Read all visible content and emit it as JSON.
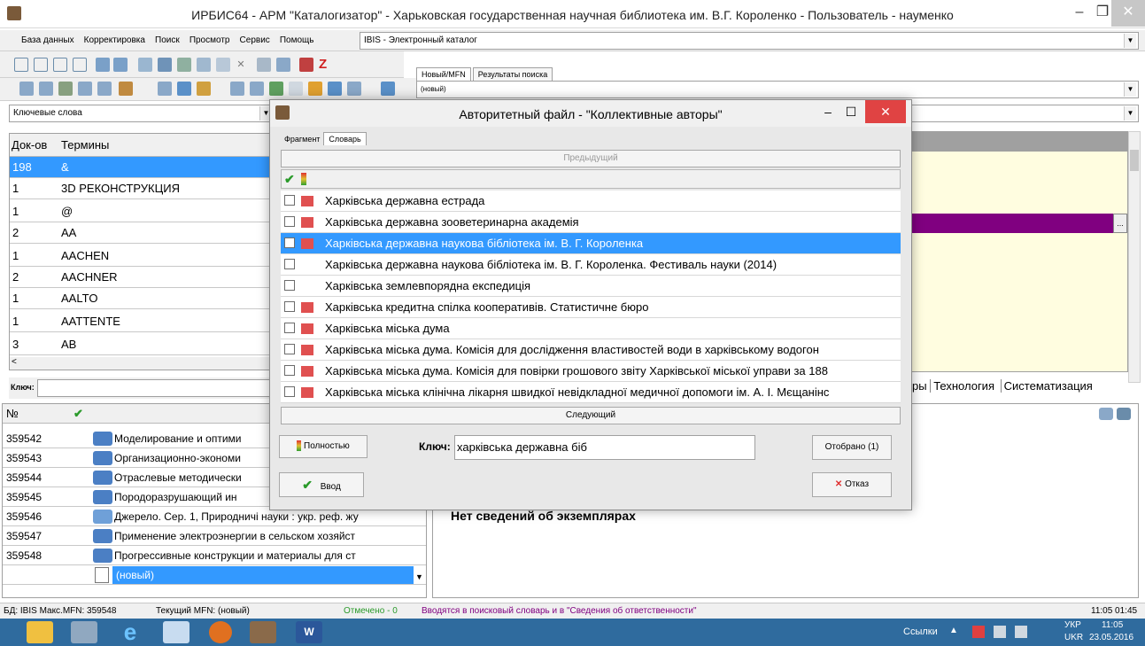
{
  "window": {
    "title": "ИРБИС64 - АРМ \"Каталогизатор\" - Харьковская государственная научная библиотека им. В.Г. Короленко - Пользователь - науменко"
  },
  "menu": [
    "База данных",
    "Корректировка",
    "Поиск",
    "Просмотр",
    "Сервис",
    "Помощь"
  ],
  "db_combo": "IBIS - Электронный каталог",
  "top_tabs": [
    "Новый/MFN",
    "Результаты поиска"
  ],
  "record_combo": "(новый)",
  "search_combo": "Ключевые слова",
  "terms": {
    "headers": [
      "Док-ов",
      "Термины"
    ],
    "rows": [
      {
        "count": "198",
        "term": "&"
      },
      {
        "count": "1",
        "term": "3D РЕКОНСТРУКЦИЯ"
      },
      {
        "count": "1",
        "term": "@"
      },
      {
        "count": "2",
        "term": "AA"
      },
      {
        "count": "1",
        "term": "AACHEN"
      },
      {
        "count": "2",
        "term": "AACHNER"
      },
      {
        "count": "1",
        "term": "AALTO"
      },
      {
        "count": "1",
        "term": "AATTENTE"
      },
      {
        "count": "3",
        "term": "AB"
      }
    ],
    "key_label": "Ключ:"
  },
  "right_tabs": [
    "ры",
    "Технология",
    "Систематизация"
  ],
  "records": {
    "header": "№",
    "rows": [
      {
        "mfn": "359542",
        "text": "Моделирование и оптими"
      },
      {
        "mfn": "359543",
        "text": "Организационно-экономи"
      },
      {
        "mfn": "359544",
        "text": "Отраслевые методически"
      },
      {
        "mfn": "359545",
        "text": "Породоразрушающий ин"
      },
      {
        "mfn": "359546",
        "text": "Джерело. Сер. 1, Природничі науки : укр. реф. жу"
      },
      {
        "mfn": "359547",
        "text": "Применение электроэнергии в сельском хозяйст"
      },
      {
        "mfn": "359548",
        "text": "Прогрессивные конструкции и материалы для ст"
      },
      {
        "mfn": "",
        "text": "(новый)"
      }
    ]
  },
  "no_copies": "Нет сведений об экземплярах",
  "dialog": {
    "title": "Авторитетный файл - \"Коллективные авторы\"",
    "tabs": [
      "Фрагмент",
      "Словарь"
    ],
    "prev": "Предыдущий",
    "next": "Следующий",
    "items": [
      {
        "text": "Харківська державна естрада",
        "checked": false,
        "tree": true
      },
      {
        "text": "Харківська державна зооветеринарна академія",
        "checked": false,
        "tree": true
      },
      {
        "text": "Харківська державна наукова бібліотека ім. В. Г. Короленка",
        "checked": true,
        "tree": true
      },
      {
        "text": "Харківська державна наукова бібліотека ім. В. Г. Короленка. Фестиваль науки (2014)",
        "checked": false,
        "tree": false
      },
      {
        "text": "Харківська землевпорядна експедиція",
        "checked": false,
        "tree": false
      },
      {
        "text": "Харківська кредитна спілка кооперативів. Статистичне бюро",
        "checked": false,
        "tree": true
      },
      {
        "text": "Харківська міська дума",
        "checked": false,
        "tree": true
      },
      {
        "text": "Харківська міська дума. Комісія для дослідження властивостей води в харківському водогон",
        "checked": false,
        "tree": true
      },
      {
        "text": "Харківська міська дума. Комісія для повірки грошового звіту Харківської міської управи за 188",
        "checked": false,
        "tree": true
      },
      {
        "text": "Харківська міська клінічна лікарня швидкої невідкладної медичної допомоги ім. А. І. Мєщанінс",
        "checked": false,
        "tree": true
      }
    ],
    "full_btn": "Полностью",
    "key_label": "Ключ:",
    "key_value": "харківська державна біб",
    "selected_btn": "Отобрано (1)",
    "enter_btn": "Ввод",
    "cancel_btn": "Отказ"
  },
  "status": {
    "db": "БД: IBIS Макс.MFN: 359548",
    "current": "Текущий MFN: (новый)",
    "marked": "Отмечено - 0",
    "hint": "Вводятся в поисковый словарь и в \"Сведения об ответственности\"",
    "time": "11:05 01:45"
  },
  "taskbar": {
    "links": "Ссылки",
    "lang": "УКР",
    "lang2": "UKR",
    "clock": "11:05",
    "date": "23.05.2016"
  }
}
